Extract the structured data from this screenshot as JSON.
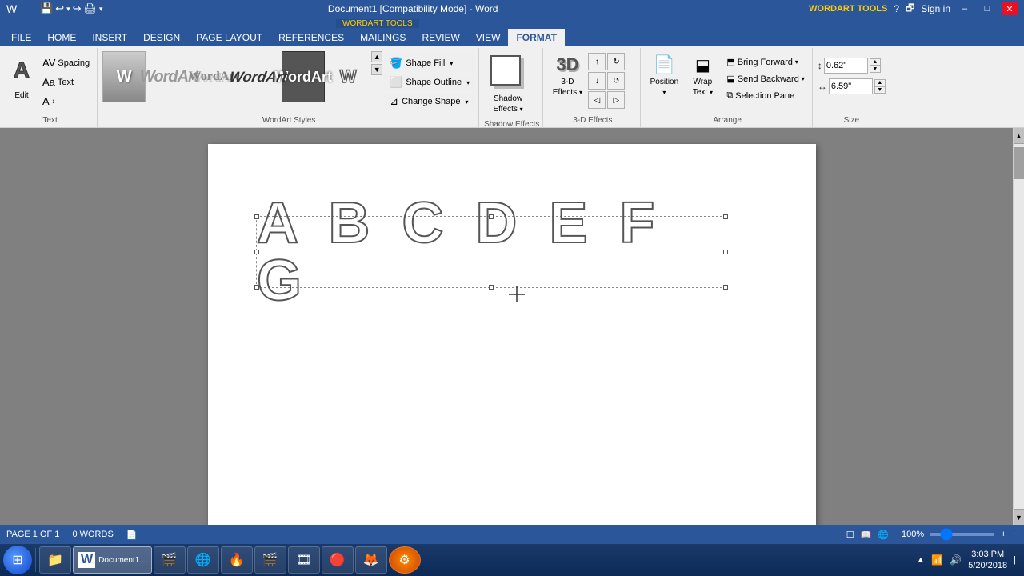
{
  "titlebar": {
    "title": "Document1 [Compatibility Mode] - Word",
    "wordart_tools_label": "WORDART TOOLS",
    "controls": [
      "–",
      "□",
      "✕"
    ],
    "help_btn": "?",
    "restore_btn": "🗗",
    "signin": "Sign in"
  },
  "quickaccess": {
    "buttons": [
      "💾",
      "↩",
      "↩",
      "↪",
      "🖨",
      "↩",
      "↩",
      "📋"
    ]
  },
  "tabs": {
    "file": "FILE",
    "home": "HOME",
    "insert": "INSERT",
    "design": "DESIGN",
    "page_layout": "PAGE LAYOUT",
    "references": "REFERENCES",
    "mailings": "MAILINGS",
    "review": "REVIEW",
    "view": "VIEW",
    "format": "FORMAT"
  },
  "ribbon": {
    "text_group": {
      "label": "Text",
      "edit_label": "Edit",
      "edit_icon": "A",
      "spacing_label": "Spacing",
      "text_label": "Text",
      "small_btns": [
        "Aa",
        "Aa",
        "A↔"
      ]
    },
    "wordart_styles": {
      "label": "WordArt Styles",
      "shape_fill": "Shape Fill",
      "shape_outline": "Shape Outline",
      "change_shape": "Change Shape"
    },
    "shadow_effects": {
      "label": "Shadow Effects",
      "btn_label": "Shadow\nEffects"
    },
    "td_effects": {
      "label": "3-D Effects",
      "btn_label": "3-D\nEffects",
      "small_btns": [
        "↻",
        "↺",
        "↑",
        "↓",
        "◁",
        "▷"
      ]
    },
    "arrange": {
      "label": "Arrange",
      "position_label": "Position",
      "wrap_text_label": "Wrap\nText",
      "bring_forward": "Bring Forward",
      "send_backward": "Send Backward",
      "selection_pane": "Selection Pane"
    },
    "size": {
      "label": "Size",
      "height_value": "0.62\"",
      "width_value": "6.59\"",
      "expand_icon": "⊡"
    }
  },
  "wordart": {
    "text": "A B C D E F G"
  },
  "statusbar": {
    "page_info": "PAGE 1 OF 1",
    "words": "0 WORDS",
    "proofing_icon": "📄",
    "zoom": "100%",
    "zoom_level": 100
  },
  "taskbar": {
    "start_icon": "⊞",
    "time": "3:03 PM",
    "date": "5/20/2018",
    "apps": [
      "📁",
      "W",
      "🎬",
      "🌐",
      "🔥",
      "🎬",
      "🎞",
      "🔴",
      "🦊",
      "⚙"
    ]
  }
}
